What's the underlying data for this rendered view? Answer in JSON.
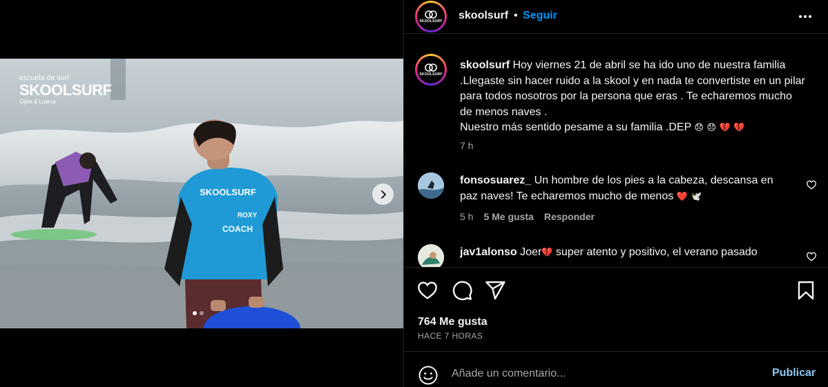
{
  "colors": {
    "background": "#000000",
    "text_primary": "#f5f5f5",
    "text_secondary": "#a8a8a8",
    "follow_blue": "#0095f6",
    "publish_blue_disabled": "#8ec7f0",
    "divider": "#262626",
    "heart_red": "#e0245e"
  },
  "media": {
    "overlay_logo": {
      "tagline": "escuela de surf",
      "wordmark": "SKOOLSURF",
      "locations": "Gijon & Luarca"
    },
    "shirt_text": {
      "brand": "SKOOLSURF",
      "sponsor": "ROXY",
      "role": "COACH"
    },
    "carousel": {
      "total": 2,
      "current": 1
    },
    "icons": {
      "next": "chevron-right-icon"
    }
  },
  "header": {
    "username": "skoolsurf",
    "separator": "•",
    "follow_label": "Seguir",
    "avatar_logo_text": "SKOOLSURF",
    "more_icon": "more-horizontal-icon"
  },
  "caption": {
    "username": "skoolsurf",
    "text": "Hoy viernes 21 de abril se ha ido uno de nuestra familia .Llegaste sin hacer ruido a la skool y en nada te convertiste en un pilar para todos nosotros por la persona que eras . Te echaremos mucho de menos naves .",
    "text_line2": "Nuestro más sentido pesame a su familia .DEP",
    "emojis": [
      "😞",
      "😞",
      "💔",
      "💔"
    ],
    "time": "7 h"
  },
  "comments": [
    {
      "username": "fonsosuarez_",
      "text": "Un hombre de los pies a la cabeza, descansa en paz naves! Te echaremos mucho de menos",
      "emojis": [
        "❤️",
        "🕊️"
      ],
      "time": "5 h",
      "likes": "5 Me gusta",
      "reply_label": "Responder",
      "like_icon": "heart-outline-icon"
    },
    {
      "username": "jav1alonso",
      "text_before": "Joer",
      "emoji": "💔",
      "text_after": "super atento y positivo, el verano pasado",
      "like_icon": "heart-outline-icon"
    }
  ],
  "actions": {
    "icons": [
      "heart-outline-icon",
      "comment-icon",
      "share-icon",
      "bookmark-icon"
    ],
    "likes_count": "764 Me gusta",
    "posted_ago": "HACE 7 HORAS"
  },
  "comment_box": {
    "placeholder": "Añade un comentario...",
    "publish_label": "Publicar",
    "emoji_icon": "smiley-icon"
  }
}
